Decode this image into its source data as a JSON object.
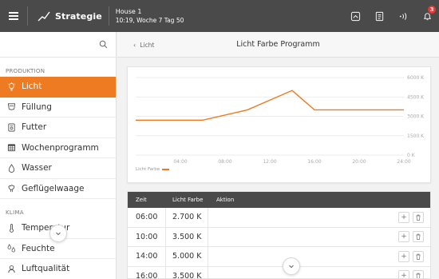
{
  "topbar": {
    "app_name": "Strategie",
    "house_name": "House 1",
    "house_time": "10:19, Woche 7 Tag 50",
    "notification_count": "3",
    "icons": [
      "menu-icon",
      "strategy-icon",
      "dashboard-icon",
      "clipboard-icon",
      "signal-icon",
      "bell-icon"
    ]
  },
  "sidebar": {
    "search_icon": "search-icon",
    "sections": [
      {
        "title": "PRODUKTION",
        "items": [
          {
            "label": "Licht",
            "icon": "lightbulb-icon",
            "active": true
          },
          {
            "label": "Füllung",
            "icon": "feeder-icon",
            "active": false
          },
          {
            "label": "Futter",
            "icon": "feed-icon",
            "active": false
          },
          {
            "label": "Wochenprogramm",
            "icon": "calendar-icon",
            "active": false
          },
          {
            "label": "Wasser",
            "icon": "water-drop-icon",
            "active": false
          },
          {
            "label": "Geflügelwaage",
            "icon": "scale-icon",
            "active": false
          }
        ]
      },
      {
        "title": "KLIMA",
        "items": [
          {
            "label": "Temperatur",
            "icon": "thermometer-icon",
            "active": false
          },
          {
            "label": "Feuchte",
            "icon": "humidity-icon",
            "active": false
          },
          {
            "label": "Luftqualität",
            "icon": "air-quality-icon",
            "active": false
          }
        ]
      }
    ]
  },
  "main": {
    "breadcrumb": "Licht",
    "title": "Licht Farbe Programm",
    "legend_label": "Licht Farbe",
    "table": {
      "headers": [
        "Zeit",
        "Licht Farbe",
        "Aktion"
      ],
      "rows": [
        {
          "zeit": "06:00",
          "farbe": "2.700 K"
        },
        {
          "zeit": "10:00",
          "farbe": "3.500 K"
        },
        {
          "zeit": "14:00",
          "farbe": "5.000 K"
        },
        {
          "zeit": "16:00",
          "farbe": "3.500 K"
        }
      ]
    }
  },
  "chart_data": {
    "type": "line",
    "series": [
      {
        "name": "Licht Farbe",
        "x": [
          "00:00",
          "06:00",
          "10:00",
          "14:00",
          "16:00",
          "24:00"
        ],
        "values": [
          2700,
          2700,
          3500,
          5000,
          3500,
          3500
        ]
      }
    ],
    "x_ticks": [
      "04:00",
      "08:00",
      "12:00",
      "16:00",
      "20:00",
      "24:00"
    ],
    "y_ticks": [
      "0 K",
      "1500 K",
      "3000 K",
      "4500 K",
      "6000 K"
    ],
    "ylim": [
      0,
      6000
    ],
    "xlim": [
      0,
      24
    ],
    "grid": true,
    "legend": "bottom-left",
    "color": "#ee7a22"
  },
  "colors": {
    "accent": "#ee7a22",
    "topbar": "#4a4a4a",
    "badge": "#e53935"
  }
}
